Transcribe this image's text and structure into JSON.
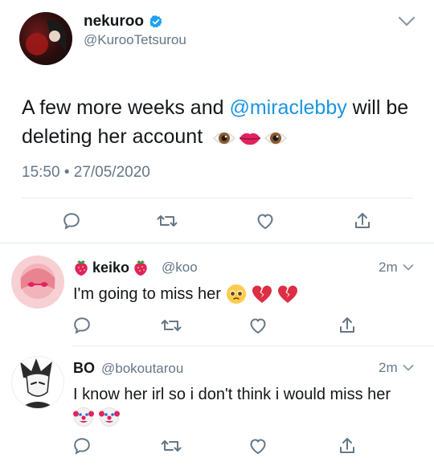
{
  "main_tweet": {
    "author_name": "nekuroo",
    "author_handle": "@KurooTetsurou",
    "text_part1": "A few more weeks and ",
    "mention": "@miraclebby",
    "text_part2": " will be deleting her account",
    "timestamp": "15:50 • 27/05/2020",
    "emojis": [
      "eye-emoji",
      "lips-emoji",
      "eye-emoji"
    ]
  },
  "replies": [
    {
      "author_name": "keiko",
      "author_handle": "@koo",
      "time": "2m",
      "text": "I'm going to miss her",
      "emojis": [
        "pleading-face-emoji",
        "broken-heart-emoji",
        "broken-heart-emoji"
      ]
    },
    {
      "author_name": "BO",
      "author_handle": "@bokoutarou",
      "time": "2m",
      "text": "I know her irl so i don't think i would miss her",
      "emojis": [
        "clown-face-emoji",
        "clown-face-emoji"
      ]
    }
  ],
  "colors": {
    "verified": "#1da1f2",
    "mention": "#1b95e0",
    "muted": "#657786",
    "divider": "#e6ecf0"
  }
}
